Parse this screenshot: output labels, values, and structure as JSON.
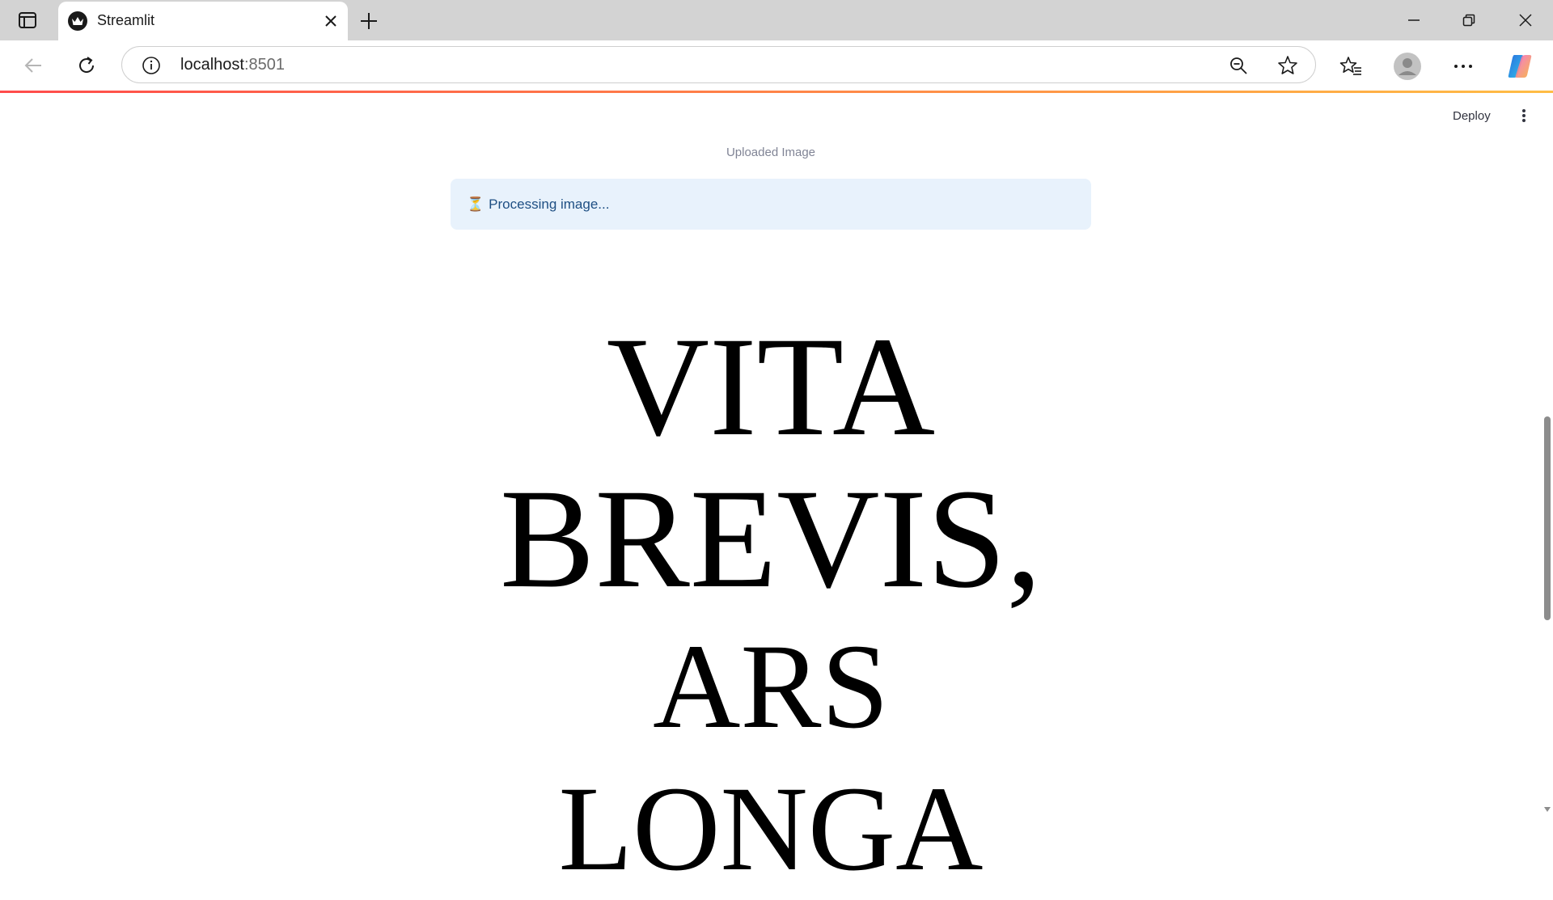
{
  "browser": {
    "tab_title": "Streamlit",
    "url_host": "localhost",
    "url_port": ":8501"
  },
  "app": {
    "header": {
      "deploy_label": "Deploy"
    },
    "image_caption": "Uploaded Image",
    "status": {
      "icon": "⏳",
      "message": "Processing image..."
    },
    "image_text": {
      "line1": "VITA",
      "line2": "BREVIS,",
      "line3": "ARS LONGA"
    }
  },
  "icons": {
    "sidebar_toggle": "sidebar-icon",
    "favicon": "crown-icon",
    "close": "close-icon",
    "new_tab": "plus-icon",
    "back": "back-arrow-icon",
    "reload": "reload-icon",
    "info": "info-icon",
    "zoom": "zoom-out-icon",
    "favorite": "star-icon",
    "favorites_list": "favorites-icon",
    "profile": "profile-icon",
    "more": "more-icon",
    "copilot": "copilot-icon",
    "app_menu": "kebab-menu-icon"
  },
  "colors": {
    "alert_bg": "#e8f2fc",
    "alert_text": "#1e4f83",
    "decoration_start": "#ff4b4b",
    "decoration_end": "#ffbd45"
  }
}
